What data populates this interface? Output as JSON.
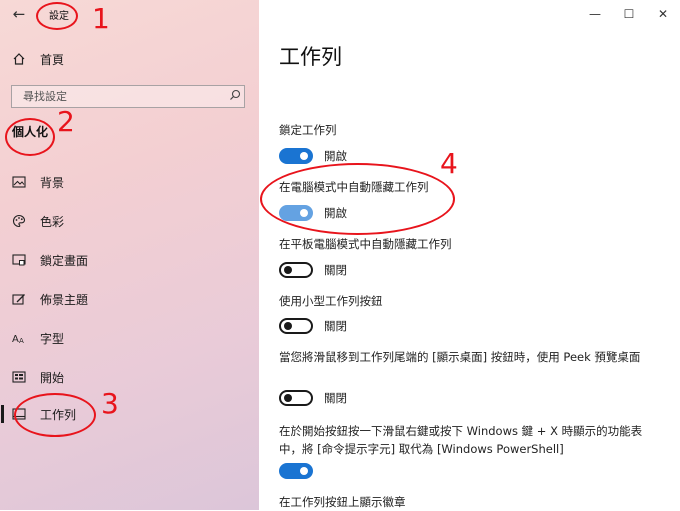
{
  "window": {
    "title": "設定",
    "back_glyph": "←",
    "controls": {
      "minimize": "—",
      "maximize": "☐",
      "close": "✕"
    }
  },
  "sidebar": {
    "home": {
      "label": "首頁",
      "icon": "home-icon"
    },
    "search": {
      "placeholder": "尋找設定",
      "icon": "search-icon"
    },
    "section_title": "個人化",
    "items": [
      {
        "label": "背景",
        "icon": "image-icon"
      },
      {
        "label": "色彩",
        "icon": "palette-icon"
      },
      {
        "label": "鎖定畫面",
        "icon": "lock-screen-icon"
      },
      {
        "label": "佈景主題",
        "icon": "theme-icon"
      },
      {
        "label": "字型",
        "icon": "font-icon"
      },
      {
        "label": "開始",
        "icon": "start-icon"
      },
      {
        "label": "工作列",
        "icon": "taskbar-icon",
        "active": true
      }
    ]
  },
  "main": {
    "title": "工作列",
    "settings": [
      {
        "label": "鎖定工作列",
        "state": "開啟",
        "on": true
      },
      {
        "label": "在電腦模式中自動隱藏工作列",
        "state": "開啟",
        "on": true
      },
      {
        "label": "在平板電腦模式中自動隱藏工作列",
        "state": "關閉",
        "on": false
      },
      {
        "label": "使用小型工作列按鈕",
        "state": "關閉",
        "on": false
      },
      {
        "label": "當您將滑鼠移到工作列尾端的 [顯示桌面] 按鈕時，使用 Peek 預覽桌面",
        "state": "關閉",
        "on": false
      },
      {
        "label": "在於開始按鈕按一下滑鼠右鍵或按下 Windows 鍵 + X 時顯示的功能表中，將 [命令提示字元] 取代為 [Windows PowerShell]",
        "state": "",
        "on": true
      },
      {
        "label": "在工作列按鈕上顯示徽章"
      }
    ]
  },
  "annotations": [
    "1",
    "2",
    "3",
    "4"
  ],
  "colors": {
    "accent": "#1a74d2",
    "annotation": "#e8141c"
  }
}
